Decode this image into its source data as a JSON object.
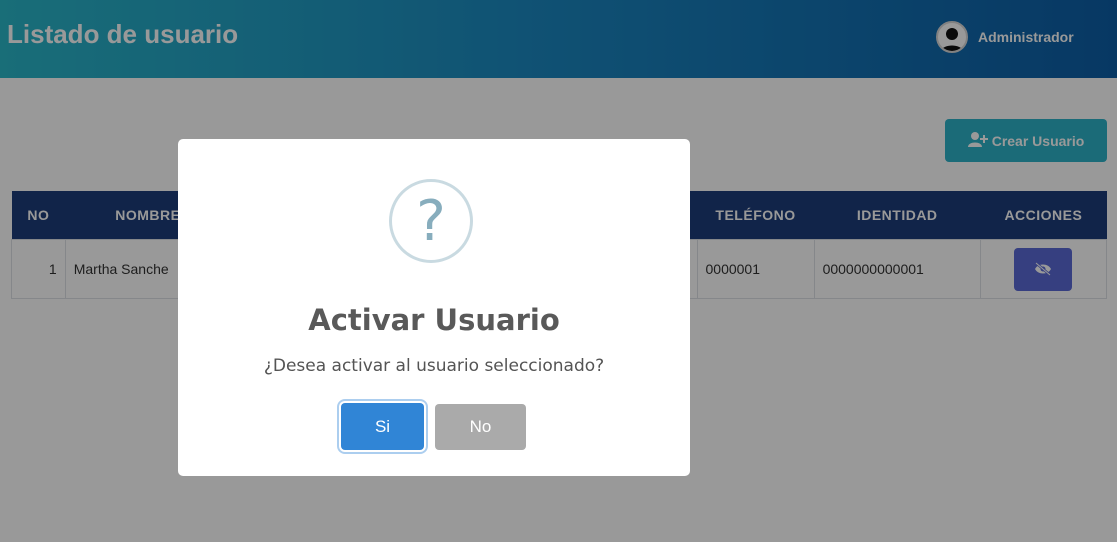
{
  "header": {
    "title": "Listado de usuario",
    "user_name": "Administrador"
  },
  "toolbar": {
    "create_label": "Crear Usuario"
  },
  "table": {
    "columns": [
      "NO",
      "NOMBRE",
      "",
      "",
      "TELÉFONO",
      "IDENTIDAD",
      "ACCIONES"
    ],
    "rows": [
      {
        "no": "1",
        "name": "Martha Sanche",
        "phone": "0000001",
        "identity": "0000000000001"
      }
    ]
  },
  "dialog": {
    "icon": "?",
    "title": "Activar Usuario",
    "message": "¿Desea activar al usuario seleccionado?",
    "confirm_label": "Si",
    "cancel_label": "No"
  },
  "colors": {
    "header_gradient_start": "#2ab7c9",
    "header_gradient_end": "#0d5ea6",
    "table_header": "#1d3c7a",
    "confirm_button": "#3085d6",
    "cancel_button": "#aaaaaa",
    "action_button": "#5b6ad6"
  }
}
